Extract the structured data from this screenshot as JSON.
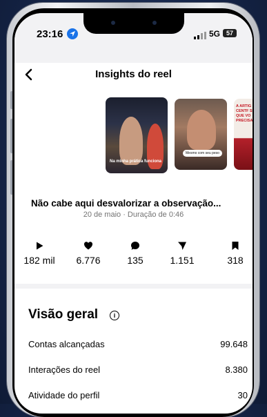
{
  "status": {
    "time": "23:16",
    "network": "5G",
    "battery": "57"
  },
  "header": {
    "title": "Insights do reel"
  },
  "thumbnails": [
    {
      "caption": "Na minha prática funciona"
    },
    {
      "caption": "Mesmo com seu peso"
    },
    {
      "text": "A ARTIG CENTF SEMA QUE VO PRECISA"
    }
  ],
  "reel": {
    "title": "Não cabe aqui desvalorizar a observação...",
    "meta": "20 de maio · Duração de 0:46"
  },
  "metrics": [
    {
      "icon": "play-icon",
      "value": "182 mil"
    },
    {
      "icon": "heart-icon",
      "value": "6.776"
    },
    {
      "icon": "comment-icon",
      "value": "135"
    },
    {
      "icon": "share-icon",
      "value": "1.151"
    },
    {
      "icon": "save-icon",
      "value": "318"
    }
  ],
  "overview": {
    "title": "Visão geral",
    "info_icon": "i",
    "rows": [
      {
        "label": "Contas alcançadas",
        "value": "99.648"
      },
      {
        "label": "Interações do reel",
        "value": "8.380"
      },
      {
        "label": "Atividade do perfil",
        "value": "30"
      }
    ]
  },
  "colors": {
    "accent": "#1a73e8",
    "text": "#000000",
    "muted": "#737373",
    "divider": "#f2f2f4"
  }
}
